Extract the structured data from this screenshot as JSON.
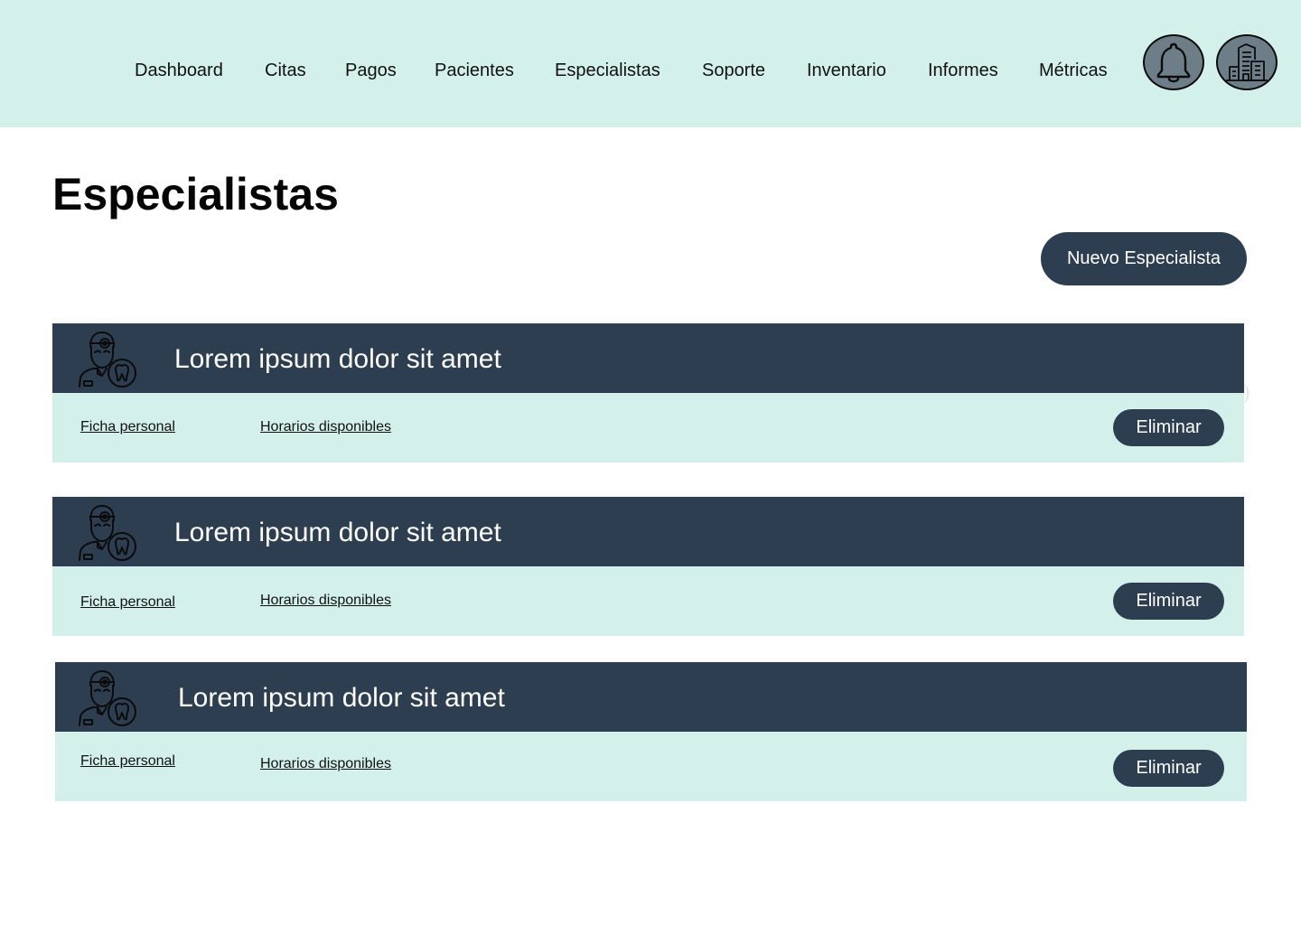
{
  "nav": {
    "items": [
      "Dashboard",
      "Citas",
      "Pagos",
      "Pacientes",
      "Especialistas",
      "Soporte",
      "Inventario",
      "Informes",
      "Métricas"
    ],
    "icons": {
      "notifications": "bell-icon",
      "organization": "buildings-icon"
    }
  },
  "page": {
    "title": "Especialistas",
    "new_button": "Nuevo Especialista"
  },
  "specialists": [
    {
      "name": "Lorem ipsum dolor sit amet",
      "link_profile": "Ficha personal",
      "link_schedule": "Horarios disponibles",
      "delete_label": "Eliminar",
      "icon": "dentist-doctor-icon"
    },
    {
      "name": "Lorem ipsum dolor sit amet",
      "link_profile": "Ficha personal",
      "link_schedule": "Horarios disponibles",
      "delete_label": "Eliminar",
      "icon": "dentist-doctor-icon"
    },
    {
      "name": "Lorem ipsum dolor sit amet",
      "link_profile": "Ficha personal",
      "link_schedule": "Horarios disponibles",
      "delete_label": "Eliminar",
      "icon": "dentist-doctor-icon"
    }
  ],
  "colors": {
    "header_bg": "#d3f1ea",
    "dark_accent": "#2e3e51",
    "icon_circle": "#6e7e88"
  }
}
